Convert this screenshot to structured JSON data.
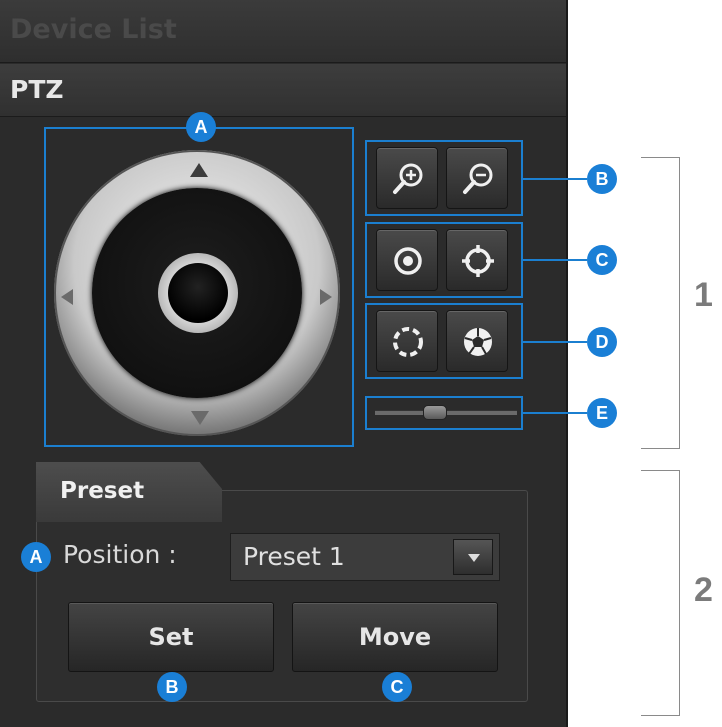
{
  "panel": {
    "device_list_title": "Device List",
    "ptz_title": "PTZ"
  },
  "callouts": {
    "joystick": "A",
    "zoom": "B",
    "focus": "C",
    "iris": "D",
    "speed": "E",
    "position": "A",
    "set": "B",
    "move": "C"
  },
  "sections": {
    "ptz_number": "1",
    "preset_number": "2"
  },
  "icons": {
    "zoom_in": "zoom-in-icon",
    "zoom_out": "zoom-out-icon",
    "focus_near": "focus-near-icon",
    "focus_far": "focus-far-icon",
    "iris_close": "iris-close-icon",
    "iris_open": "iris-open-icon"
  },
  "speed_slider": {
    "level": 0.4
  },
  "preset": {
    "tab_label": "Preset",
    "position_label": "Position :",
    "position_value": "Preset 1",
    "set_label": "Set",
    "move_label": "Move"
  },
  "colors": {
    "callout": "#1a7fd6",
    "highlight_border": "#1b7fd0",
    "panel_bg": "#2b2b2b"
  }
}
